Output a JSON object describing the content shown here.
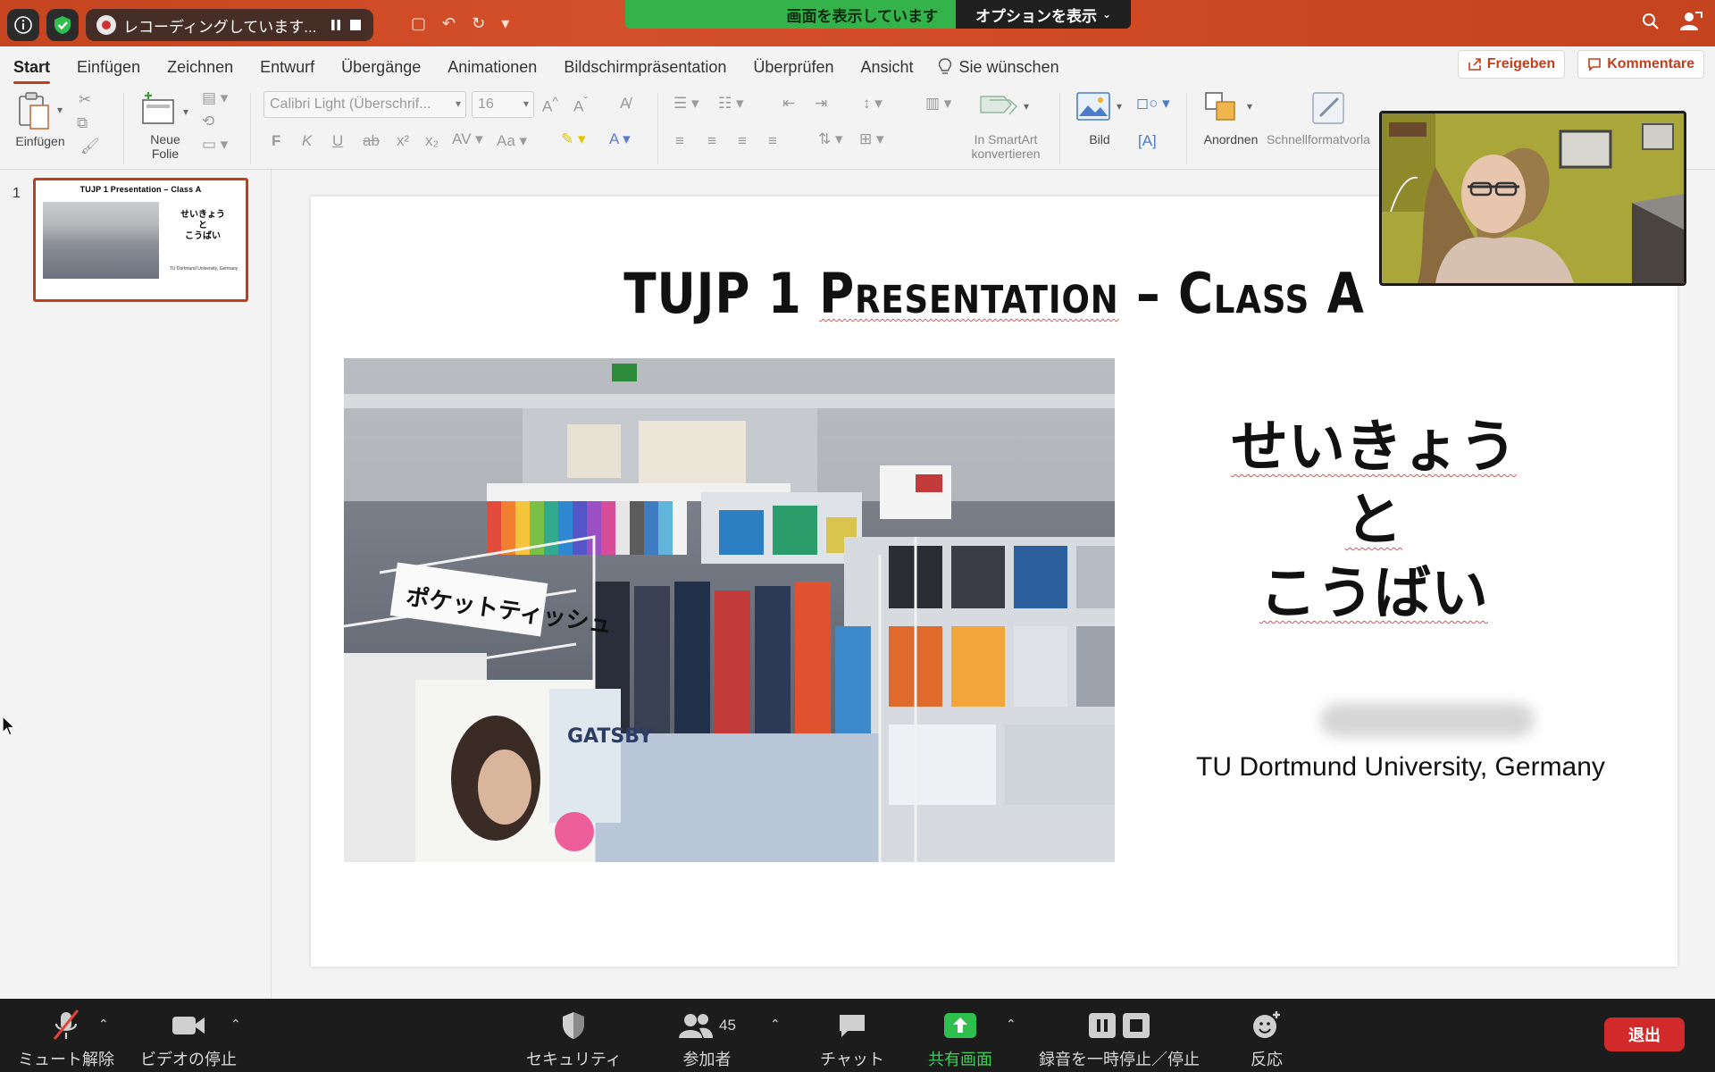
{
  "titlebar": {
    "recording_label": "レコーディングしています...",
    "share_banner": "画面を表示しています",
    "share_options": "オプションを表示"
  },
  "tabs": [
    {
      "label": "Start",
      "active": true
    },
    {
      "label": "Einfügen"
    },
    {
      "label": "Zeichnen"
    },
    {
      "label": "Entwurf"
    },
    {
      "label": "Übergänge"
    },
    {
      "label": "Animationen"
    },
    {
      "label": "Bildschirmpräsentation"
    },
    {
      "label": "Überprüfen"
    },
    {
      "label": "Ansicht"
    }
  ],
  "tell_me": "Sie wünschen",
  "actions": {
    "share": "Freigeben",
    "comments": "Kommentare"
  },
  "ribbon": {
    "paste": "Einfügen",
    "new_slide": "Neue\nFolie",
    "font_name": "Calibri Light (Überschrif...",
    "font_size": "16",
    "smartart": "In SmartArt\nkonvertieren",
    "picture": "Bild",
    "arrange": "Anordnen",
    "quick_styles": "Schnellformatvorla"
  },
  "thumbnail": {
    "number": "1",
    "title": "TUJP 1 Presentation – Class A",
    "jp_lines": [
      "せいきょう",
      "と",
      "こうばい"
    ],
    "university": "TU Dortmund University, Germany"
  },
  "slide": {
    "title_pre": "TUJP 1 ",
    "title_squig": "Presentation",
    "title_post": " – Class A",
    "jp_line1": "せいきょう",
    "jp_line2": "と",
    "jp_line3": "こうばい",
    "university": "TU Dortmund University, Germany",
    "photo_sign": "ポケットティッシュ",
    "photo_brand": "GATSBY"
  },
  "bottombar": {
    "unmute": "ミュート解除",
    "stop_video": "ビデオの停止",
    "security": "セキュリティ",
    "participants": "参加者",
    "participant_count": "45",
    "chat": "チャット",
    "share_screen": "共有画面",
    "pause_recording": "録音を一時停止／停止",
    "reactions": "反応",
    "end": "退出"
  },
  "colors": {
    "accent": "#c43e1c",
    "zoom_green": "#34b34a",
    "end_red": "#d22a2a"
  }
}
